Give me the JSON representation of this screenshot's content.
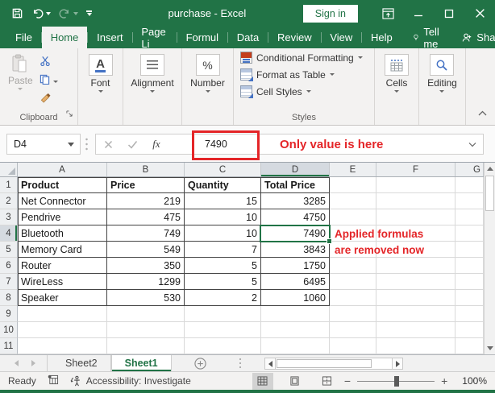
{
  "titlebar": {
    "title": "purchase - Excel",
    "sign_in": "Sign in"
  },
  "tabs": {
    "items": [
      "File",
      "Home",
      "Insert",
      "Page Li",
      "Formul",
      "Data",
      "Review",
      "View",
      "Help"
    ],
    "active": "Home",
    "tell_me": "Tell me",
    "share": "Share"
  },
  "ribbon": {
    "clipboard": {
      "label": "Clipboard",
      "paste": "Paste"
    },
    "font": {
      "label": "Font",
      "symbol": "A"
    },
    "alignment": {
      "label": "Alignment"
    },
    "number": {
      "label": "Number",
      "symbol": "%"
    },
    "styles": {
      "label": "Styles",
      "items": [
        "Conditional Formatting",
        "Format as Table",
        "Cell Styles"
      ]
    },
    "cells": {
      "label": "Cells"
    },
    "editing": {
      "label": "Editing"
    }
  },
  "formula_bar": {
    "name_box": "D4",
    "fx": "fx",
    "value": "7490",
    "annotation": "Only value is here"
  },
  "grid": {
    "col_headers": [
      "A",
      "B",
      "C",
      "D",
      "E",
      "F",
      "G"
    ],
    "selected_col": "D",
    "selected_row": "4",
    "selected_cell": "D4",
    "rows": [
      {
        "n": "1",
        "cells": [
          "Product",
          "Price",
          "Quantity",
          "Total Price",
          "",
          "",
          ""
        ]
      },
      {
        "n": "2",
        "cells": [
          "Net Connector",
          "219",
          "15",
          "3285",
          "",
          "",
          ""
        ]
      },
      {
        "n": "3",
        "cells": [
          "Pendrive",
          "475",
          "10",
          "4750",
          "",
          "",
          ""
        ]
      },
      {
        "n": "4",
        "cells": [
          "Bluetooth",
          "749",
          "10",
          "7490",
          "",
          "",
          ""
        ]
      },
      {
        "n": "5",
        "cells": [
          "Memory Card",
          "549",
          "7",
          "3843",
          "",
          "",
          ""
        ]
      },
      {
        "n": "6",
        "cells": [
          "Router",
          "350",
          "5",
          "1750",
          "",
          "",
          ""
        ]
      },
      {
        "n": "7",
        "cells": [
          "WireLess",
          "1299",
          "5",
          "6495",
          "",
          "",
          ""
        ]
      },
      {
        "n": "8",
        "cells": [
          "Speaker",
          "530",
          "2",
          "1060",
          "",
          "",
          ""
        ]
      },
      {
        "n": "9",
        "cells": [
          "",
          "",
          "",
          "",
          "",
          "",
          ""
        ]
      },
      {
        "n": "10",
        "cells": [
          "",
          "",
          "",
          "",
          "",
          "",
          ""
        ]
      },
      {
        "n": "11",
        "cells": [
          "",
          "",
          "",
          "",
          "",
          "",
          ""
        ]
      }
    ],
    "annotation_line1": "Applied formulas",
    "annotation_line2": "are removed now"
  },
  "sheetbar": {
    "sheets": [
      "Sheet2",
      "Sheet1"
    ],
    "active": "Sheet1"
  },
  "statusbar": {
    "mode": "Ready",
    "accessibility": "Accessibility: Investigate",
    "zoom_level": "100%"
  },
  "colors": {
    "excel_green": "#217346",
    "annotation_red": "#e42528",
    "selection_border": "#217346"
  }
}
